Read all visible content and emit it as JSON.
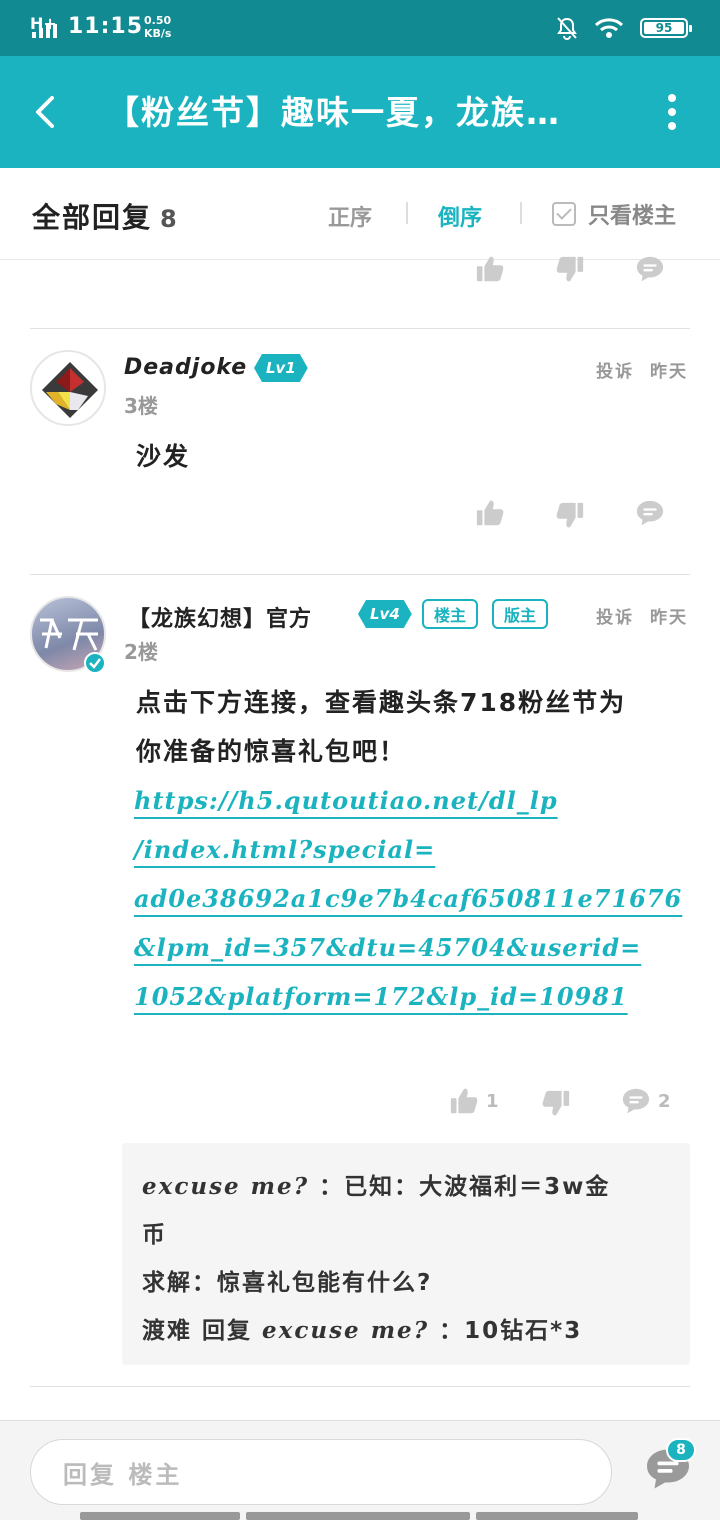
{
  "status_bar": {
    "network": "H+",
    "time": "11:15",
    "speed_value": "0.50",
    "speed_unit": "KB/s",
    "battery": "95",
    "icons": [
      "signal-icon",
      "mute-icon",
      "wifi-icon",
      "battery-icon"
    ]
  },
  "header": {
    "title": "【粉丝节】趣味一夏，龙族…",
    "back_icon": "back-arrow-icon",
    "more_icon": "more-vertical-icon"
  },
  "reply_bar": {
    "all_label": "全部回复",
    "count": "8",
    "sort_asc": "正序",
    "sort_desc": "倒序",
    "only_owner": "只看楼主"
  },
  "posts": [
    {
      "username": "Deadjoke",
      "level": "Lv1",
      "floor": "3楼",
      "report": "投诉",
      "time": "昨天",
      "content": "沙发"
    },
    {
      "username": "【龙族幻想】官方",
      "level": "Lv4",
      "tag_owner": "楼主",
      "tag_mod": "版主",
      "floor": "2楼",
      "report": "投诉",
      "time": "昨天",
      "content_line1": "点击下方连接，查看趣头条718粉丝节为",
      "content_line2": "你准备的惊喜礼包吧！",
      "link_lines": [
        "https://h5.qutoutiao.net/dl_lp",
        "/index.html?special=",
        "ad0e38692a1c9e7b4caf650811e71676",
        "&lpm_id=357&dtu=45704&userid=",
        "1052&platform=172&lp_id=10981"
      ],
      "likes": "1",
      "comments": "2",
      "sub_replies": {
        "r1_user": "excuse me?",
        "r1_text": "：已知：大波福利＝3w金",
        "r1_text2": "币",
        "r2_text": "求解：惊喜礼包能有什么?",
        "r3_user": "渡难",
        "r3_mid": "回复",
        "r3_target": "excuse me?",
        "r3_text": "：10钻石*3"
      }
    }
  ],
  "bottom_bar": {
    "placeholder": "回复 楼主",
    "badge": "8"
  },
  "colors": {
    "accent": "#1ab3bf",
    "status_bar": "#128a92"
  }
}
